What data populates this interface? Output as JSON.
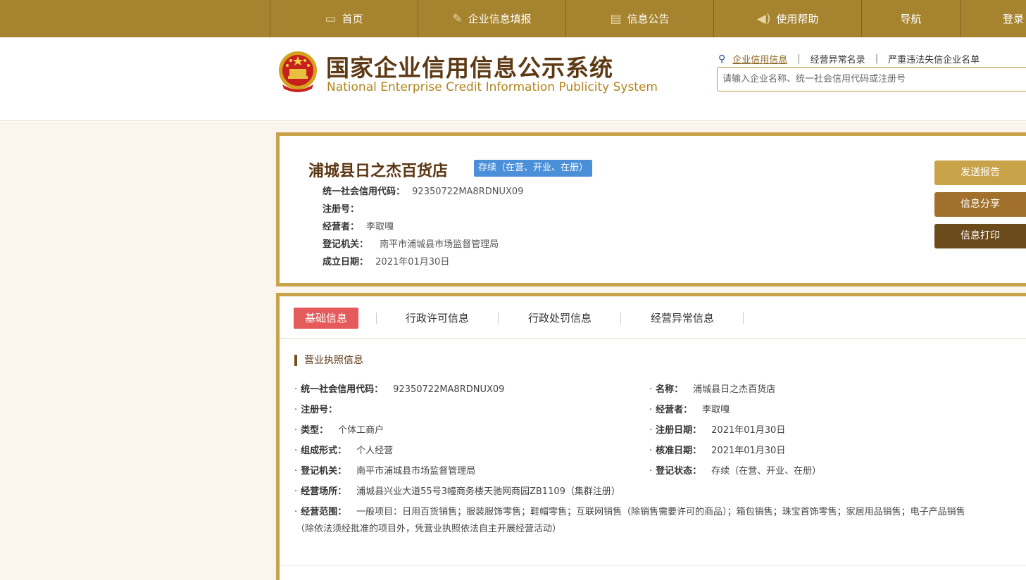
{
  "nav": {
    "items": [
      {
        "label": "首页",
        "icon": "monitor-icon"
      },
      {
        "label": "企业信息填报",
        "icon": "pen-icon"
      },
      {
        "label": "信息公告",
        "icon": "document-icon"
      },
      {
        "label": "使用帮助",
        "icon": "speaker-icon"
      },
      {
        "label": "导航",
        "icon": ""
      },
      {
        "label": "登录",
        "icon": ""
      }
    ]
  },
  "header": {
    "title_cn": "国家企业信用信息公示系统",
    "title_en": "National Enterprise Credit Information Publicity System",
    "search_links": [
      "企业信用信息",
      "经营异常名录",
      "严重违法失信企业名单"
    ],
    "search_placeholder": "请输入企业名称、统一社会信用代码或注册号"
  },
  "summary": {
    "name": "浦城县日之杰百货店",
    "status": "存续（在营、开业、在册）",
    "rows": [
      {
        "label": "统一社会信用代码：",
        "value": "92350722MA8RDNUX09"
      },
      {
        "label": "注册号：",
        "value": ""
      },
      {
        "label": "经营者：",
        "value": "李取嘎"
      },
      {
        "label": "登记机关：",
        "value": "南平市浦城县市场监督管理局"
      },
      {
        "label": "成立日期：",
        "value": "2021年01月30日"
      }
    ],
    "buttons": [
      "发送报告",
      "信息分享",
      "信息打印"
    ]
  },
  "tabs": [
    "基础信息",
    "行政许可信息",
    "行政处罚信息",
    "经营异常信息"
  ],
  "license": {
    "section_title": "营业执照信息",
    "left": [
      {
        "label": "统一社会信用代码：",
        "value": "92350722MA8RDNUX09"
      },
      {
        "label": "注册号：",
        "value": ""
      },
      {
        "label": "类型：",
        "value": "个体工商户"
      },
      {
        "label": "组成形式：",
        "value": "个人经营"
      },
      {
        "label": "登记机关：",
        "value": "南平市浦城县市场监督管理局"
      },
      {
        "label": "经营场所：",
        "value": "浦城县兴业大道55号3幢商务楼天驰网商园ZB1109（集群注册）"
      },
      {
        "label": "经营范围：",
        "value": "一般项目：日用百货销售；服装服饰零售；鞋帽零售；互联网销售（除销售需要许可的商品）；箱包销售；珠宝首饰零售；家居用品销售；电子产品销售"
      }
    ],
    "right": [
      {
        "label": "名称：",
        "value": "浦城县日之杰百货店"
      },
      {
        "label": "经营者：",
        "value": "李取嘎"
      },
      {
        "label": "注册日期：",
        "value": "2021年01月30日"
      },
      {
        "label": "核准日期：",
        "value": "2021年01月30日"
      },
      {
        "label": "登记状态：",
        "value": "存续（在营、开业、在册）"
      }
    ],
    "scope_continuation": "（除依法须经批准的项目外，凭营业执照依法自主开展经营活动）"
  }
}
